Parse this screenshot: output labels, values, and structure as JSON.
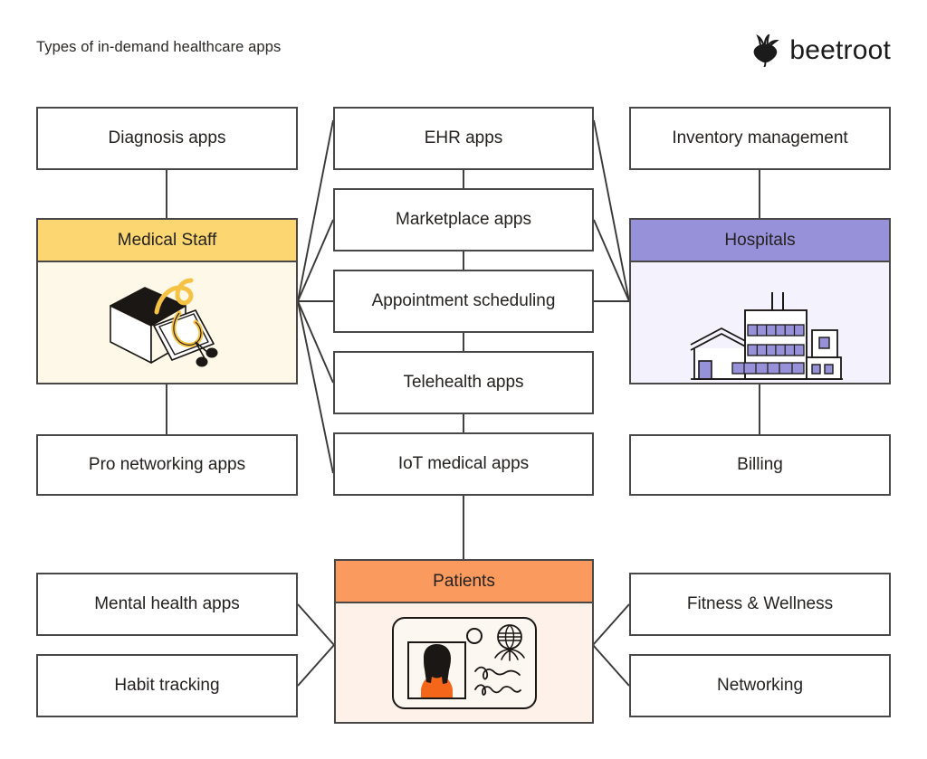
{
  "page": {
    "title": "Types of in-demand healthcare apps",
    "brand": "beetroot",
    "brand_icon": "beetroot-icon"
  },
  "colors": {
    "medical_staff_header": "#FCD670",
    "medical_staff_body": "#FDF8E7",
    "hospitals_header": "#9691D8",
    "hospitals_body": "#F4F2FD",
    "patients_header": "#FB9A5E",
    "patients_body": "#FDF1EA",
    "border": "#4A4846",
    "text": "#24211F",
    "background": "#FFFFFF"
  },
  "chart_data": {
    "type": "diagram",
    "title": "Types of in-demand healthcare apps",
    "entities": [
      {
        "id": "medical-staff",
        "label": "Medical Staff",
        "illustration": "box-book-stethoscope-icon"
      },
      {
        "id": "hospitals",
        "label": "Hospitals",
        "illustration": "hospital-building-icon"
      },
      {
        "id": "patients",
        "label": "Patients",
        "illustration": "patient-id-card-icon"
      }
    ],
    "apps": [
      {
        "id": "diagnosis-apps",
        "label": "Diagnosis apps"
      },
      {
        "id": "pro-networking-apps",
        "label": "Pro networking apps"
      },
      {
        "id": "ehr-apps",
        "label": "EHR apps"
      },
      {
        "id": "marketplace-apps",
        "label": "Marketplace apps"
      },
      {
        "id": "appointment-scheduling",
        "label": "Appointment scheduling"
      },
      {
        "id": "telehealth-apps",
        "label": "Telehealth apps"
      },
      {
        "id": "iot-medical-apps",
        "label": "IoT medical apps"
      },
      {
        "id": "inventory-management",
        "label": "Inventory management"
      },
      {
        "id": "billing",
        "label": "Billing"
      },
      {
        "id": "mental-health-apps",
        "label": "Mental health apps"
      },
      {
        "id": "habit-tracking",
        "label": "Habit tracking"
      },
      {
        "id": "fitness-wellness",
        "label": "Fitness & Wellness"
      },
      {
        "id": "networking",
        "label": "Networking"
      }
    ],
    "links": [
      {
        "from": "diagnosis-apps",
        "to": "medical-staff"
      },
      {
        "from": "pro-networking-apps",
        "to": "medical-staff"
      },
      {
        "from": "medical-staff",
        "to": "ehr-apps"
      },
      {
        "from": "medical-staff",
        "to": "marketplace-apps"
      },
      {
        "from": "medical-staff",
        "to": "appointment-scheduling"
      },
      {
        "from": "medical-staff",
        "to": "telehealth-apps"
      },
      {
        "from": "medical-staff",
        "to": "iot-medical-apps"
      },
      {
        "from": "ehr-apps",
        "to": "hospitals"
      },
      {
        "from": "marketplace-apps",
        "to": "hospitals"
      },
      {
        "from": "appointment-scheduling",
        "to": "hospitals"
      },
      {
        "from": "inventory-management",
        "to": "hospitals"
      },
      {
        "from": "hospitals",
        "to": "billing"
      },
      {
        "from": "ehr-apps",
        "to": "marketplace-apps"
      },
      {
        "from": "marketplace-apps",
        "to": "appointment-scheduling"
      },
      {
        "from": "appointment-scheduling",
        "to": "telehealth-apps"
      },
      {
        "from": "telehealth-apps",
        "to": "iot-medical-apps"
      },
      {
        "from": "iot-medical-apps",
        "to": "patients"
      },
      {
        "from": "mental-health-apps",
        "to": "patients"
      },
      {
        "from": "habit-tracking",
        "to": "patients"
      },
      {
        "from": "fitness-wellness",
        "to": "patients"
      },
      {
        "from": "networking",
        "to": "patients"
      }
    ]
  },
  "nodes": {
    "diagnosis_apps": "Diagnosis apps",
    "pro_networking_apps": "Pro networking apps",
    "ehr_apps": "EHR apps",
    "marketplace_apps": "Marketplace apps",
    "appointment_scheduling": "Appointment scheduling",
    "telehealth_apps": "Telehealth apps",
    "iot_medical_apps": "IoT medical apps",
    "inventory_management": "Inventory management",
    "billing": "Billing",
    "mental_health_apps": "Mental health apps",
    "habit_tracking": "Habit tracking",
    "fitness_wellness": "Fitness & Wellness",
    "networking": "Networking",
    "medical_staff": "Medical Staff",
    "hospitals": "Hospitals",
    "patients": "Patients"
  }
}
